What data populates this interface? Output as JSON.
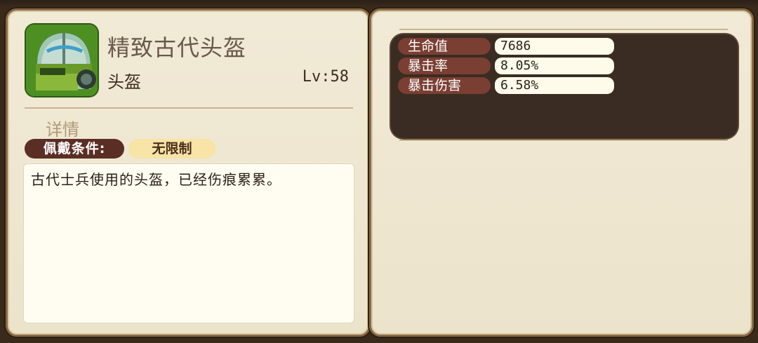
{
  "item": {
    "name": "精致古代头盔",
    "type": "头盔",
    "level": "Lv:58",
    "icon": "helmet-icon"
  },
  "details": {
    "section_title": "详情",
    "requirement_label": "佩戴条件:",
    "requirement_value": "无限制",
    "description": "古代士兵使用的头盔，已经伤痕累累。"
  },
  "stats": [
    {
      "label": "生命值",
      "value": "7686"
    },
    {
      "label": "暴击率",
      "value": "8.05%"
    },
    {
      "label": "暴击伤害",
      "value": "6.58%"
    }
  ]
}
